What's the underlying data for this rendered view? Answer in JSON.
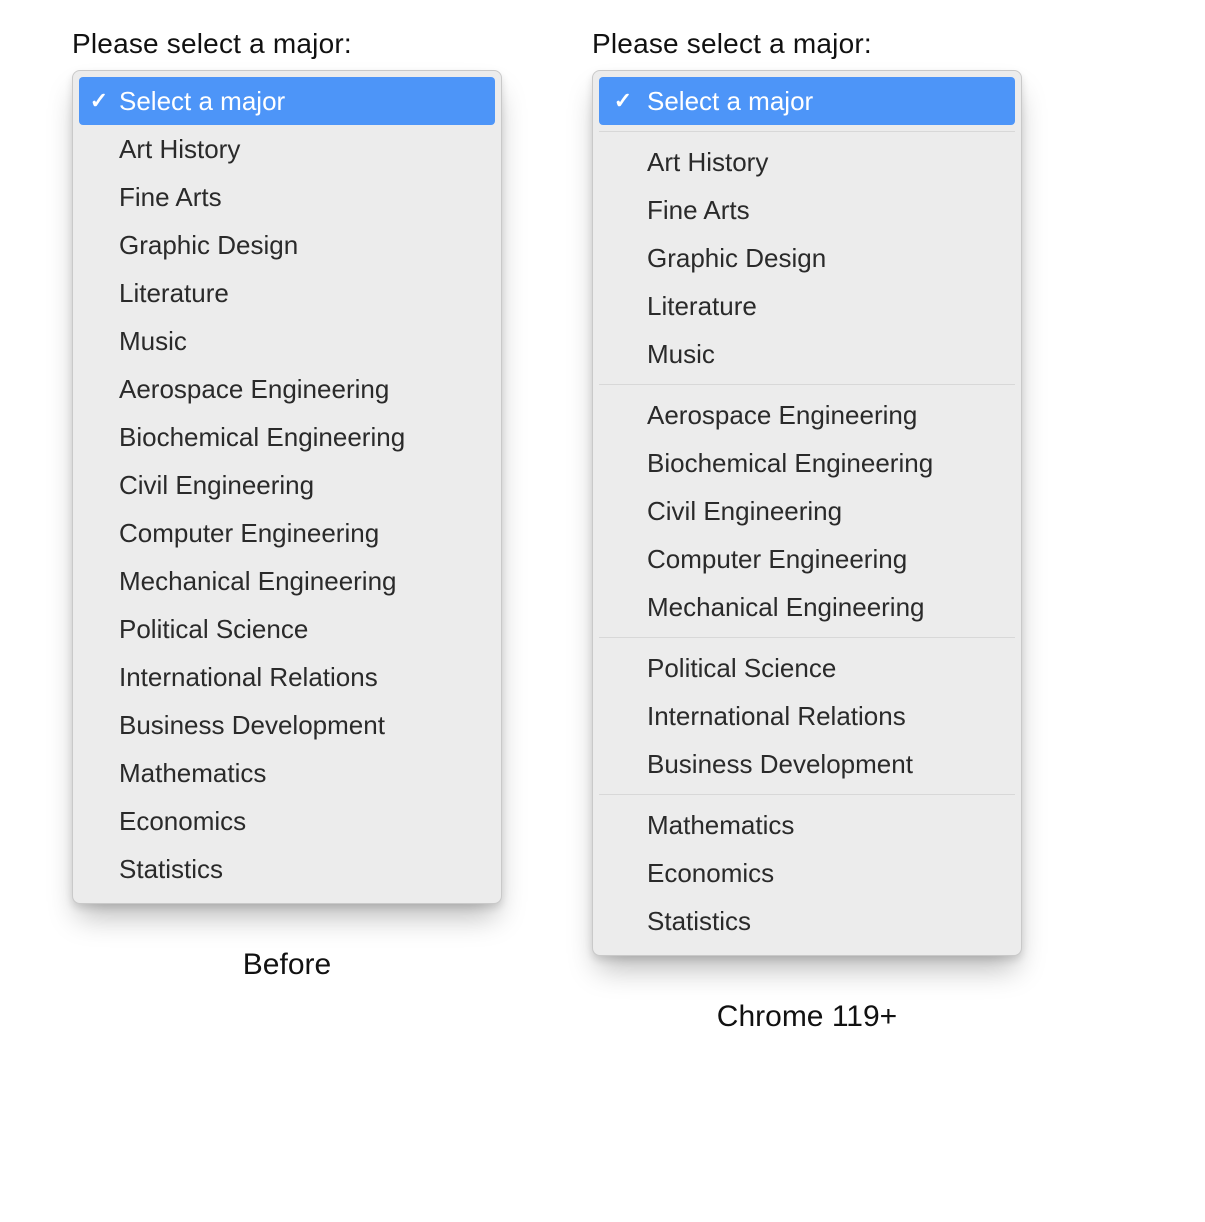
{
  "prompt_label": "Please select a major:",
  "placeholder": "Select a major",
  "captions": {
    "before": "Before",
    "after": "Chrome 119+"
  },
  "flat_options": [
    "Art History",
    "Fine Arts",
    "Graphic Design",
    "Literature",
    "Music",
    "Aerospace Engineering",
    "Biochemical Engineering",
    "Civil Engineering",
    "Computer Engineering",
    "Mechanical Engineering",
    "Political Science",
    "International Relations",
    "Business Development",
    "Mathematics",
    "Economics",
    "Statistics"
  ],
  "grouped_options": [
    [
      "Art History",
      "Fine Arts",
      "Graphic Design",
      "Literature",
      "Music"
    ],
    [
      "Aerospace Engineering",
      "Biochemical Engineering",
      "Civil Engineering",
      "Computer Engineering",
      "Mechanical Engineering"
    ],
    [
      "Political Science",
      "International Relations",
      "Business Development"
    ],
    [
      "Mathematics",
      "Economics",
      "Statistics"
    ]
  ],
  "colors": {
    "accent": "#4d95f8",
    "menu_bg": "#ececec"
  }
}
